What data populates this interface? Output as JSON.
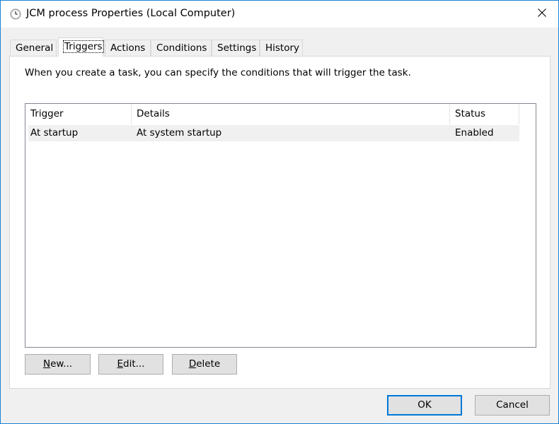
{
  "window": {
    "title": "JCM process Properties (Local Computer)"
  },
  "tabs": [
    {
      "label": "General"
    },
    {
      "label": "Triggers"
    },
    {
      "label": "Actions"
    },
    {
      "label": "Conditions"
    },
    {
      "label": "Settings"
    },
    {
      "label": "History"
    }
  ],
  "active_tab": "Triggers",
  "panel": {
    "description": "When you create a task, you can specify the conditions that will trigger the task."
  },
  "listview": {
    "columns": [
      "Trigger",
      "Details",
      "Status"
    ],
    "rows": [
      {
        "trigger": "At startup",
        "details": "At system startup",
        "status": "Enabled"
      }
    ]
  },
  "buttons": {
    "new_mnemonic": "N",
    "new_rest": "ew...",
    "edit_mnemonic": "E",
    "edit_rest": "dit...",
    "delete_mnemonic": "D",
    "delete_rest": "elete",
    "ok": "OK",
    "cancel": "Cancel"
  },
  "colors": {
    "window_border": "#1883d7",
    "default_button_border": "#0078d7",
    "selected_row": "#f0f0f0"
  },
  "icons": {
    "title": "clock-icon",
    "close": "close-icon"
  }
}
